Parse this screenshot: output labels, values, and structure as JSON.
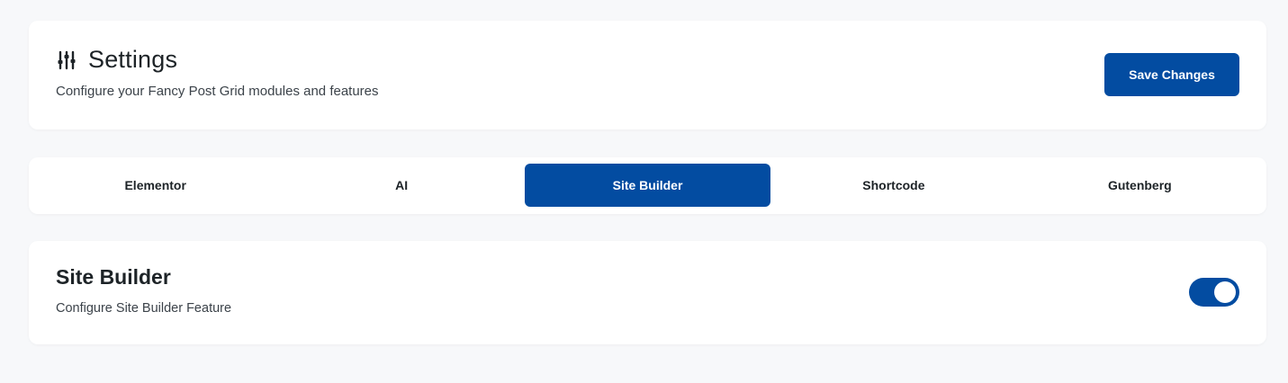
{
  "header": {
    "icon": "sliders-icon",
    "title": "Settings",
    "subtitle": "Configure your Fancy Post Grid modules and features",
    "save_label": "Save Changes"
  },
  "tabs": [
    {
      "label": "Elementor",
      "active": false
    },
    {
      "label": "AI",
      "active": false
    },
    {
      "label": "Site Builder",
      "active": true
    },
    {
      "label": "Shortcode",
      "active": false
    },
    {
      "label": "Gutenberg",
      "active": false
    }
  ],
  "feature": {
    "title": "Site Builder",
    "description": "Configure Site Builder Feature",
    "enabled": true
  },
  "colors": {
    "accent": "#034ca1",
    "background": "#f7f8fa",
    "card": "#ffffff"
  }
}
